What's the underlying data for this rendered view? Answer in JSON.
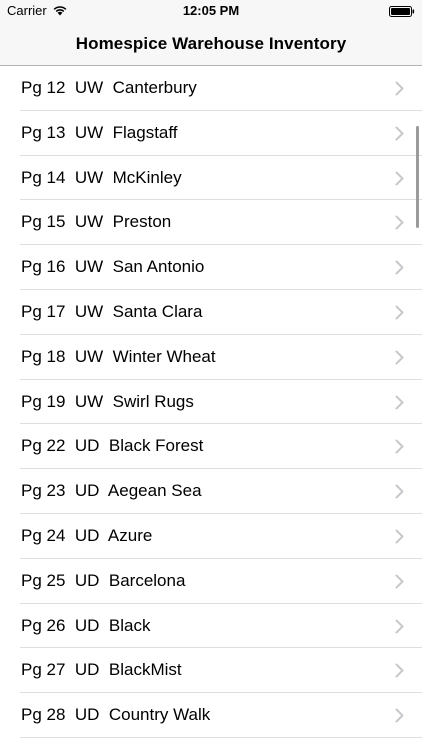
{
  "status_bar": {
    "carrier": "Carrier",
    "time": "12:05 PM"
  },
  "nav": {
    "title": "Homespice Warehouse Inventory"
  },
  "list": {
    "items": [
      {
        "label": "Pg 12  UW  Canterbury"
      },
      {
        "label": "Pg 13  UW  Flagstaff"
      },
      {
        "label": "Pg 14  UW  McKinley"
      },
      {
        "label": "Pg 15  UW  Preston"
      },
      {
        "label": "Pg 16  UW  San Antonio"
      },
      {
        "label": "Pg 17  UW  Santa Clara"
      },
      {
        "label": "Pg 18  UW  Winter Wheat"
      },
      {
        "label": "Pg 19  UW  Swirl Rugs"
      },
      {
        "label": "Pg 22  UD  Black Forest"
      },
      {
        "label": "Pg 23  UD  Aegean Sea"
      },
      {
        "label": "Pg 24  UD  Azure"
      },
      {
        "label": "Pg 25  UD  Barcelona"
      },
      {
        "label": "Pg 26  UD  Black"
      },
      {
        "label": "Pg 27  UD  BlackMist"
      },
      {
        "label": "Pg 28  UD  Country Walk"
      }
    ]
  },
  "colors": {
    "bar_background": "#f7f7f7",
    "separator": "#dedede",
    "chevron": "#c7c7cc"
  },
  "icons": {
    "wifi": "wifi-icon",
    "battery": "battery-icon",
    "disclosure": "chevron-right-icon"
  }
}
